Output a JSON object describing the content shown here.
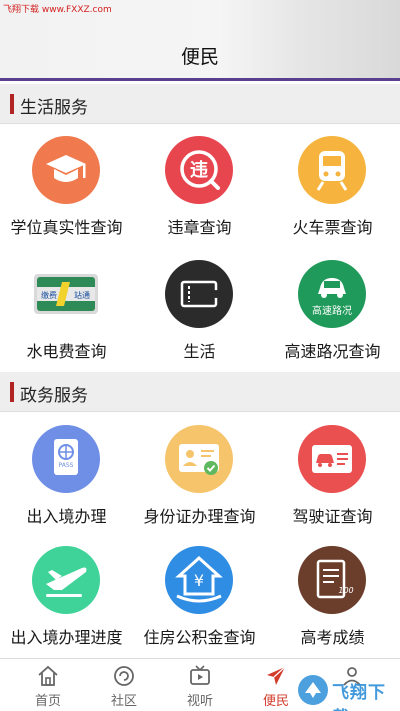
{
  "watermark_top": "飞翔下载 www.FXXZ.com",
  "header": {
    "title": "便民"
  },
  "sections": [
    {
      "title": "生活服务",
      "items": [
        {
          "label": "学位真实性查询",
          "icon": "graduation-cap-icon"
        },
        {
          "label": "违章查询",
          "icon": "traffic-violation-icon"
        },
        {
          "label": "火车票查询",
          "icon": "train-icon"
        },
        {
          "label": "水电费查询",
          "icon": "utility-card-icon",
          "card_text": "缴费 | 站通"
        },
        {
          "label": "生活",
          "icon": "ticket-icon"
        },
        {
          "label": "高速路况查询",
          "icon": "highway-car-icon",
          "badge_text": "高速路况"
        }
      ]
    },
    {
      "title": "政务服务",
      "items": [
        {
          "label": "出入境办理",
          "icon": "passport-icon",
          "badge_text": "PASS"
        },
        {
          "label": "身份证办理查询",
          "icon": "id-card-icon"
        },
        {
          "label": "驾驶证查询",
          "icon": "driver-license-icon"
        },
        {
          "label": "出入境办理进度",
          "icon": "airplane-icon"
        },
        {
          "label": "住房公积金查询",
          "icon": "house-fund-icon",
          "badge_text": "¥"
        },
        {
          "label": "高考成绩",
          "icon": "exam-score-icon",
          "badge_text": "100"
        }
      ]
    }
  ],
  "tabs": [
    {
      "label": "首页",
      "icon": "home-icon"
    },
    {
      "label": "社区",
      "icon": "community-icon"
    },
    {
      "label": "视听",
      "icon": "tv-icon"
    },
    {
      "label": "便民",
      "icon": "send-icon",
      "active": true
    },
    {
      "label": "",
      "icon": "profile-icon"
    }
  ],
  "watermark_bottom": "飞翔下载",
  "colors": {
    "header_rule": "#5a3f8c",
    "section_bar": "#b22424",
    "active_tab": "#d23a2a"
  }
}
